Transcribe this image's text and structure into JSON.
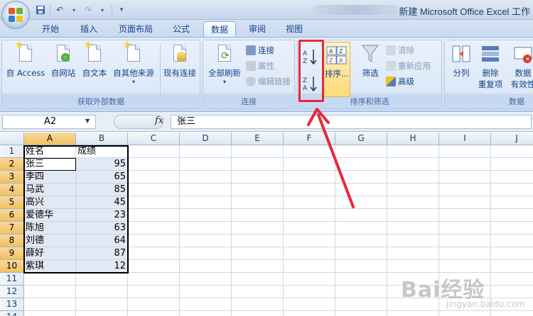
{
  "window": {
    "title": "新建 Microsoft Office Excel 工作"
  },
  "tabs": [
    {
      "label": "开始",
      "active": false
    },
    {
      "label": "插入",
      "active": false
    },
    {
      "label": "页面布局",
      "active": false
    },
    {
      "label": "公式",
      "active": false
    },
    {
      "label": "数据",
      "active": true
    },
    {
      "label": "审阅",
      "active": false
    },
    {
      "label": "视图",
      "active": false
    }
  ],
  "ribbon": {
    "external_data": {
      "label": "获取外部数据",
      "buttons": [
        "自 Access",
        "自网站",
        "自文本",
        "自其他来源",
        "现有连接"
      ]
    },
    "connections": {
      "label": "连接",
      "refresh_all": "全部刷新",
      "items": [
        {
          "label": "连接",
          "enabled": true
        },
        {
          "label": "属性",
          "enabled": false
        },
        {
          "label": "编辑链接",
          "enabled": false
        }
      ]
    },
    "sort_filter": {
      "label": "排序和筛选",
      "sort_az_icon": "sort-ascending-icon",
      "sort_za_icon": "sort-descending-icon",
      "sort_label": "排序...",
      "filter_label": "筛选",
      "items": [
        {
          "label": "清除",
          "enabled": false
        },
        {
          "label": "重新应用",
          "enabled": false
        },
        {
          "label": "高级",
          "enabled": true
        }
      ]
    },
    "data_tools": {
      "label": "数据",
      "split": "分列",
      "remove_dup_1": "删除",
      "remove_dup_2": "重复项",
      "validate_1": "数据",
      "validate_2": "有效性"
    }
  },
  "formula_bar": {
    "name_box": "A2",
    "fx": "fx",
    "content": "张三"
  },
  "sheet": {
    "columns": [
      "A",
      "B",
      "C",
      "D",
      "E",
      "F",
      "G",
      "H",
      "I",
      "J"
    ],
    "rows": [
      "1",
      "2",
      "3",
      "4",
      "5",
      "6",
      "7",
      "8",
      "9",
      "10",
      "11",
      "12",
      "13",
      "14"
    ],
    "headers": [
      "姓名",
      "成绩"
    ],
    "data": [
      {
        "name": "张三",
        "score": "95"
      },
      {
        "name": "李四",
        "score": "65"
      },
      {
        "name": "马武",
        "score": "85"
      },
      {
        "name": "高兴",
        "score": "45"
      },
      {
        "name": "爱德华",
        "score": "23"
      },
      {
        "name": "陈旭",
        "score": "63"
      },
      {
        "name": "刘德",
        "score": "64"
      },
      {
        "name": "薛好",
        "score": "87"
      },
      {
        "name": "紫琪",
        "score": "12"
      }
    ],
    "active_cell": "A2"
  },
  "annotation": {
    "color": "#e8283a"
  },
  "watermark": {
    "brand": "Bai经验",
    "site": "jingyan.baidu.com"
  }
}
